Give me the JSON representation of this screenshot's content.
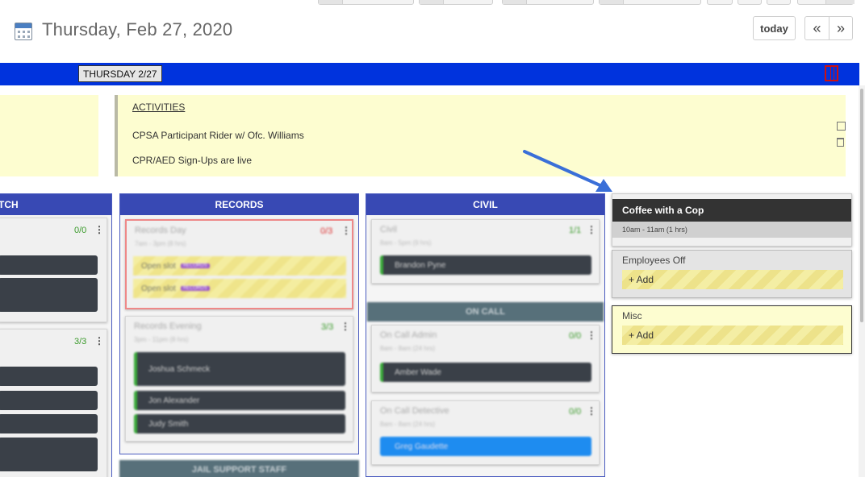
{
  "header": {
    "date_title": "Thursday, Feb 27, 2020",
    "today_label": "today",
    "prev_label": "«",
    "next_label": "»"
  },
  "day_bar": {
    "day_label": "THURSDAY 2/27",
    "color": "#0033dd"
  },
  "notes": {
    "activities_title": "ACTIVITIES",
    "lines": [
      "CPSA Participant Rider w/ Ofc. Williams",
      "CPR/AED Sign-Ups are live"
    ]
  },
  "columns": {
    "left_partial": {
      "header": "TCH",
      "counts": [
        "0/0",
        "3/3"
      ]
    },
    "records": {
      "header": "RECORDS",
      "count_top": "0/3",
      "count_bottom": "3/3",
      "bottom_section": "JAIL SUPPORT STAFF"
    },
    "civil": {
      "header": "CIVIL",
      "count_top": "1/1",
      "on_call_section": "ON CALL",
      "count_admin": "0/0",
      "count_detective": "0/0"
    }
  },
  "events": {
    "coffee": {
      "title": "Coffee with a Cop",
      "time": "10am - 11am (1 hrs)"
    },
    "employees_off": {
      "label": "Employees Off",
      "add_label": "+ Add"
    },
    "misc": {
      "label": "Misc",
      "add_label": "+ Add"
    }
  },
  "colors": {
    "column_header": "#3849b4",
    "note_background": "#fdfdd0",
    "annotation_arrow": "#3a6fd8"
  }
}
